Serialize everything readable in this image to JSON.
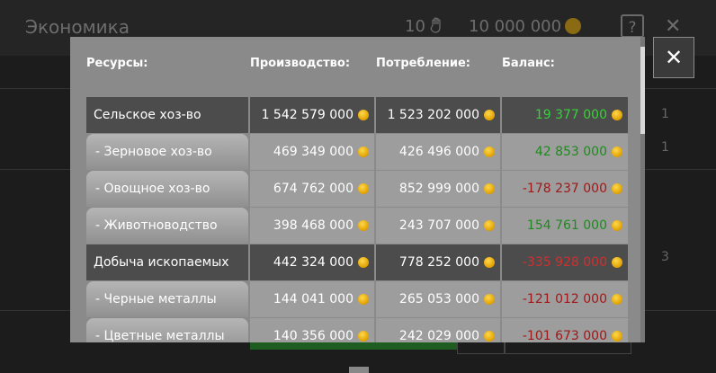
{
  "background": {
    "title": "Экономика",
    "workers_count": "10",
    "money": "10 000 000",
    "help_label": "?",
    "close_label": "✕",
    "side_values": [
      "1",
      "1",
      "3"
    ]
  },
  "modal": {
    "close_label": "✕",
    "headers": {
      "resources": "Ресурсы:",
      "production": "Производство:",
      "consumption": "Потребление:",
      "balance": "Баланс:"
    },
    "rows": [
      {
        "type": "main",
        "name": "Сельское хоз-во",
        "production": "1 542 579 000",
        "consumption": "1 523 202 000",
        "balance": "19 377 000",
        "sign": "pos"
      },
      {
        "type": "sub",
        "name": "- Зерновое хоз-во",
        "production": "469 349 000",
        "consumption": "426 496 000",
        "balance": "42 853 000",
        "sign": "pos"
      },
      {
        "type": "sub",
        "name": "- Овощное хоз-во",
        "production": "674 762 000",
        "consumption": "852 999 000",
        "balance": "-178 237 000",
        "sign": "neg"
      },
      {
        "type": "sub",
        "name": "- Животноводство",
        "production": "398 468 000",
        "consumption": "243 707 000",
        "balance": "154 761 000",
        "sign": "pos"
      },
      {
        "type": "main",
        "name": "Добыча ископаемых",
        "production": "442 324 000",
        "consumption": "778 252 000",
        "balance": "-335 928 000",
        "sign": "neg"
      },
      {
        "type": "sub",
        "name": "- Черные металлы",
        "production": "144 041 000",
        "consumption": "265 053 000",
        "balance": "-121 012 000",
        "sign": "neg"
      },
      {
        "type": "sub",
        "name": "- Цветные металлы",
        "production": "140 356 000",
        "consumption": "242 029 000",
        "balance": "-101 673 000",
        "sign": "neg"
      }
    ]
  },
  "colors": {
    "positive": "#1f8a1f",
    "negative": "#a01818",
    "coin": "#f0b400"
  }
}
